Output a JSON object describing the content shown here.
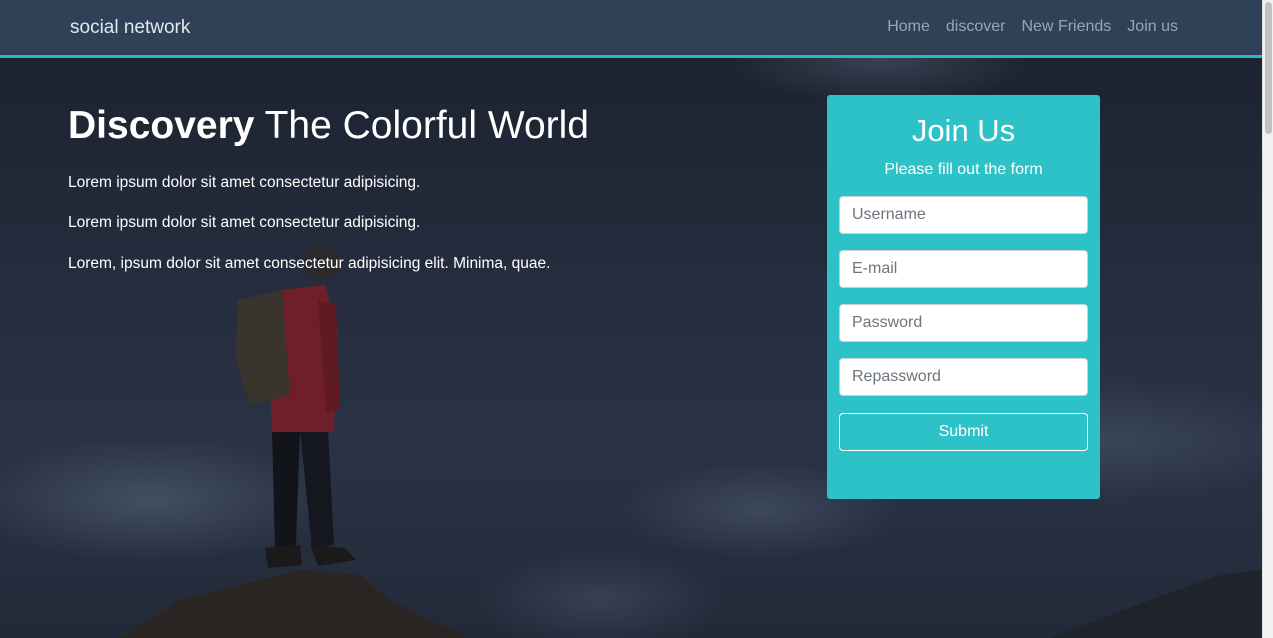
{
  "navbar": {
    "brand": "social network",
    "links": [
      "Home",
      "discover",
      "New Friends",
      "Join us"
    ]
  },
  "hero": {
    "headline_bold": "Discovery",
    "headline_rest": " The Colorful World",
    "paragraphs": [
      "Lorem ipsum dolor sit amet consectetur adipisicing.",
      "Lorem ipsum dolor sit amet consectetur adipisicing.",
      "Lorem, ipsum dolor sit amet consectetur adipisicing elit. Minima, quae."
    ]
  },
  "join_form": {
    "title": "Join Us",
    "subtitle": "Please fill out the form",
    "fields": [
      {
        "placeholder": "Username",
        "value": ""
      },
      {
        "placeholder": "E-mail",
        "value": ""
      },
      {
        "placeholder": "Password",
        "value": ""
      },
      {
        "placeholder": "Repassword",
        "value": ""
      }
    ],
    "submit_label": "Submit"
  },
  "colors": {
    "navbar_bg": "#2f4157",
    "accent": "#2bb6c0",
    "card_bg": "#2dc2c8"
  }
}
